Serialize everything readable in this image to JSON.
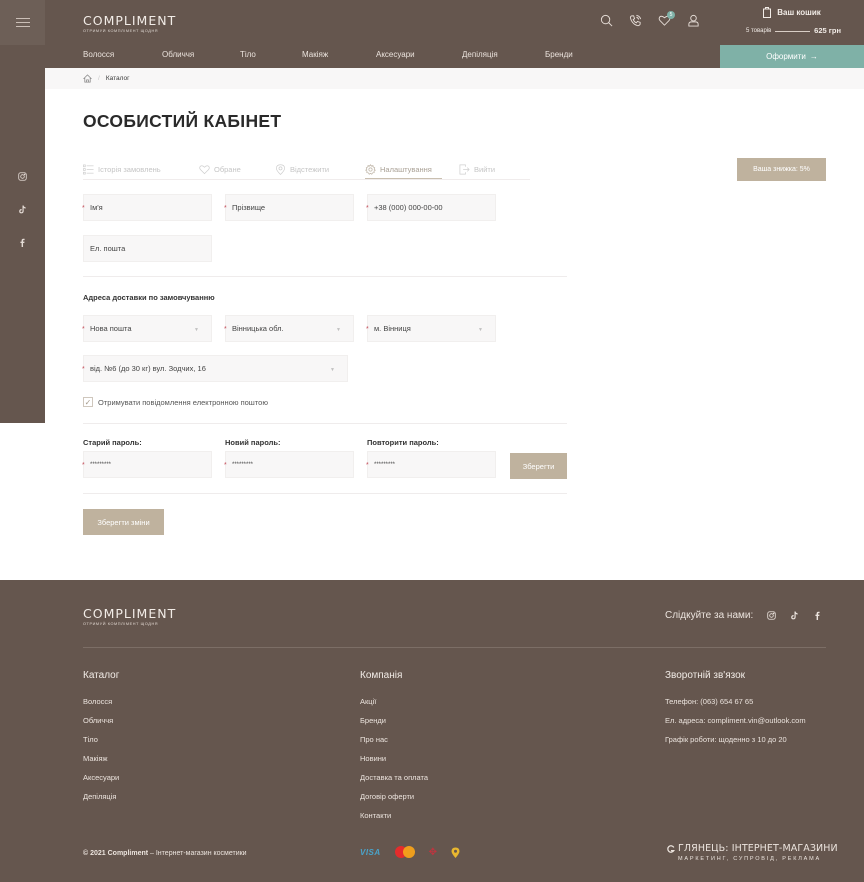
{
  "header": {
    "logo_name": "COMPLIMENT",
    "logo_tagline": "отримуй комплімент щодня",
    "nav": [
      "Волосся",
      "Обличчя",
      "Тіло",
      "Макіяж",
      "Аксесуари",
      "Депіляція",
      "Бренди"
    ],
    "icons": [
      "search-icon",
      "phone-icon",
      "heart-icon",
      "user-icon"
    ],
    "wishlist_count": "5",
    "cart": {
      "title": "Ваш кошик",
      "items": "5 товарів",
      "total": "625 грн",
      "checkout_label": "Оформити",
      "checkout_arrow": "→"
    }
  },
  "sidebar": {
    "social": [
      "instagram-icon",
      "tiktok-icon",
      "facebook-icon"
    ]
  },
  "breadcrumb": {
    "home_icon": "home-icon",
    "separator": "/",
    "current": "Каталог"
  },
  "page": {
    "title": "ОСОБИСТИЙ КАБІНЕТ",
    "tabs": [
      {
        "label": "Історія замовлень",
        "icon": "list-icon"
      },
      {
        "label": "Обране",
        "icon": "heart-icon"
      },
      {
        "label": "Відстежити",
        "icon": "location-pin-icon"
      },
      {
        "label": "Налаштування",
        "icon": "gear-icon",
        "active": true
      },
      {
        "label": "Вийти",
        "icon": "logout-icon"
      }
    ],
    "discount": "Ваша знижка: 5%"
  },
  "form": {
    "first_name_placeholder": "Ім'я",
    "last_name_placeholder": "Прізвище",
    "phone_placeholder": "+38 (000) 000-00-00",
    "email_placeholder": "Ел. пошта",
    "delivery_title": "Адреса доставки по замовчуванню",
    "carrier": "Нова пошта",
    "region": "Вінницька обл.",
    "city": "м. Вінниця",
    "branch": "від. №6 (до 30 кг) вул. Зодчих, 16",
    "required_mark": "*",
    "newsletter_label": "Отримувати повідомлення електронною поштою",
    "newsletter_checked": true,
    "old_password_label": "Старий пароль:",
    "new_password_label": "Новий пароль:",
    "repeat_password_label": "Повторити пароль:",
    "password_mask": "*********",
    "save_password_label": "Зберегти",
    "save_changes_label": "Зберегти зміни"
  },
  "footer": {
    "logo_name": "COMPLIMENT",
    "logo_tagline": "отримуй комплімент щодня",
    "follow_label": "Слідкуйте за нами:",
    "catalog_title": "Каталог",
    "catalog_links": [
      "Волосся",
      "Обличчя",
      "Тіло",
      "Макіяж",
      "Аксесуари",
      "Депіляція"
    ],
    "company_title": "Компанія",
    "company_links": [
      "Акції",
      "Бренди",
      "Про нас",
      "Новини",
      "Доставка та оплата",
      "Договір оферти",
      "Контакти"
    ],
    "contact_title": "Зворотній зв'язок",
    "contacts": [
      "Телефон: (063) 654 67 65",
      "Ел. адреса: compliment.vin@outlook.com",
      "Графік роботи: щоденно з 10 до 20"
    ],
    "copyright_bold": "© 2021 Compliment",
    "copyright_rest": " – Інтернет-магазин косметики",
    "payments": [
      "VISA",
      "mastercard-icon",
      "nova-poshta-icon",
      "location-pin-icon"
    ],
    "visa_label": "VISA",
    "agency_title": "ГЛЯНЕЦЬ: ІНТЕРНЕТ-МАГАЗИНИ",
    "agency_subtitle": "МАРКЕТИНГ, СУПРОВІД, РЕКЛАМА"
  }
}
